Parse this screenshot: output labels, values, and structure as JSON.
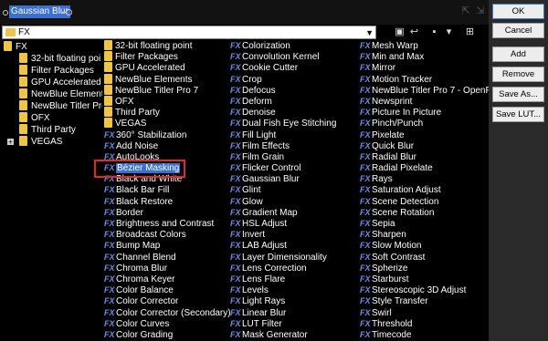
{
  "search": {
    "value": "Gaussian Blur"
  },
  "path": {
    "value": "FX"
  },
  "buttons": {
    "ok": "OK",
    "cancel": "Cancel",
    "add": "Add",
    "remove": "Remove",
    "save_as": "Save As...",
    "save_lut": "Save LUT..."
  },
  "tree": {
    "root": "FX",
    "children": [
      "32-bit floating poi",
      "Filter Packages",
      "GPU Accelerated",
      "NewBlue Elements",
      "NewBlue Titler Pro",
      "OFX",
      "Third Party",
      "VEGAS"
    ]
  },
  "columns": [
    [
      {
        "label": "32-bit floating point",
        "icon": "folder"
      },
      {
        "label": "Filter Packages",
        "icon": "folder"
      },
      {
        "label": "GPU Accelerated",
        "icon": "folder"
      },
      {
        "label": "NewBlue Elements",
        "icon": "folder"
      },
      {
        "label": "NewBlue Titler Pro 7",
        "icon": "folder"
      },
      {
        "label": "OFX",
        "icon": "folder"
      },
      {
        "label": "Third Party",
        "icon": "folder"
      },
      {
        "label": "VEGAS",
        "icon": "folder"
      },
      {
        "label": "360° Stabilization",
        "icon": "fx"
      },
      {
        "label": "Add Noise",
        "icon": "fx"
      },
      {
        "label": "AutoLooks",
        "icon": "fx"
      },
      {
        "label": "Bézier Masking",
        "icon": "fx",
        "selected": true
      },
      {
        "label": "Black and White",
        "icon": "fx"
      },
      {
        "label": "Black Bar Fill",
        "icon": "fx"
      },
      {
        "label": "Black Restore",
        "icon": "fx"
      },
      {
        "label": "Border",
        "icon": "fx"
      },
      {
        "label": "Brightness and Contrast",
        "icon": "fx"
      },
      {
        "label": "Broadcast Colors",
        "icon": "fx"
      },
      {
        "label": "Bump Map",
        "icon": "fx"
      },
      {
        "label": "Channel Blend",
        "icon": "fx"
      },
      {
        "label": "Chroma Blur",
        "icon": "fx"
      },
      {
        "label": "Chroma Keyer",
        "icon": "fx"
      },
      {
        "label": "Color Balance",
        "icon": "fx"
      },
      {
        "label": "Color Corrector",
        "icon": "fx"
      },
      {
        "label": "Color Corrector (Secondary)",
        "icon": "fx"
      },
      {
        "label": "Color Curves",
        "icon": "fx"
      },
      {
        "label": "Color Grading",
        "icon": "fx"
      }
    ],
    [
      {
        "label": "Colorization",
        "icon": "fx"
      },
      {
        "label": "Convolution Kernel",
        "icon": "fx"
      },
      {
        "label": "Cookie Cutter",
        "icon": "fx"
      },
      {
        "label": "Crop",
        "icon": "fx"
      },
      {
        "label": "Defocus",
        "icon": "fx"
      },
      {
        "label": "Deform",
        "icon": "fx"
      },
      {
        "label": "Denoise",
        "icon": "fx"
      },
      {
        "label": "Dual Fish Eye Stitching",
        "icon": "fx"
      },
      {
        "label": "Fill Light",
        "icon": "fx"
      },
      {
        "label": "Film Effects",
        "icon": "fx"
      },
      {
        "label": "Film Grain",
        "icon": "fx"
      },
      {
        "label": "Flicker Control",
        "icon": "fx"
      },
      {
        "label": "Gaussian Blur",
        "icon": "fx"
      },
      {
        "label": "Glint",
        "icon": "fx"
      },
      {
        "label": "Glow",
        "icon": "fx"
      },
      {
        "label": "Gradient Map",
        "icon": "fx"
      },
      {
        "label": "HSL Adjust",
        "icon": "fx"
      },
      {
        "label": "Invert",
        "icon": "fx"
      },
      {
        "label": "LAB Adjust",
        "icon": "fx"
      },
      {
        "label": "Layer Dimensionality",
        "icon": "fx"
      },
      {
        "label": "Lens Correction",
        "icon": "fx"
      },
      {
        "label": "Lens Flare",
        "icon": "fx"
      },
      {
        "label": "Levels",
        "icon": "fx"
      },
      {
        "label": "Light Rays",
        "icon": "fx"
      },
      {
        "label": "Linear Blur",
        "icon": "fx"
      },
      {
        "label": "LUT Filter",
        "icon": "fx"
      },
      {
        "label": "Mask Generator",
        "icon": "fx"
      }
    ],
    [
      {
        "label": "Mesh Warp",
        "icon": "fx"
      },
      {
        "label": "Min and Max",
        "icon": "fx"
      },
      {
        "label": "Mirror",
        "icon": "fx"
      },
      {
        "label": "Motion Tracker",
        "icon": "fx"
      },
      {
        "label": "NewBlue Titler Pro 7 - OpenFX",
        "icon": "fx"
      },
      {
        "label": "Newsprint",
        "icon": "fx"
      },
      {
        "label": "Picture In Picture",
        "icon": "fx"
      },
      {
        "label": "Pinch/Punch",
        "icon": "fx"
      },
      {
        "label": "Pixelate",
        "icon": "fx"
      },
      {
        "label": "Quick Blur",
        "icon": "fx"
      },
      {
        "label": "Radial Blur",
        "icon": "fx"
      },
      {
        "label": "Radial Pixelate",
        "icon": "fx"
      },
      {
        "label": "Rays",
        "icon": "fx"
      },
      {
        "label": "Saturation Adjust",
        "icon": "fx"
      },
      {
        "label": "Scene Detection",
        "icon": "fx"
      },
      {
        "label": "Scene Rotation",
        "icon": "fx"
      },
      {
        "label": "Sepia",
        "icon": "fx"
      },
      {
        "label": "Sharpen",
        "icon": "fx"
      },
      {
        "label": "Slow Motion",
        "icon": "fx"
      },
      {
        "label": "Soft Contrast",
        "icon": "fx"
      },
      {
        "label": "Spherize",
        "icon": "fx"
      },
      {
        "label": "Starburst",
        "icon": "fx"
      },
      {
        "label": "Stereoscopic 3D Adjust",
        "icon": "fx"
      },
      {
        "label": "Style Transfer",
        "icon": "fx"
      },
      {
        "label": "Swirl",
        "icon": "fx"
      },
      {
        "label": "Threshold",
        "icon": "fx"
      },
      {
        "label": "Timecode",
        "icon": "fx"
      }
    ]
  ],
  "fx_icon_text": "FX",
  "colors": {
    "selection": "#3b6fd1",
    "fx_icon": "#6a8fe6",
    "folder": "#f0c545",
    "highlight_box": "#e8232a"
  }
}
